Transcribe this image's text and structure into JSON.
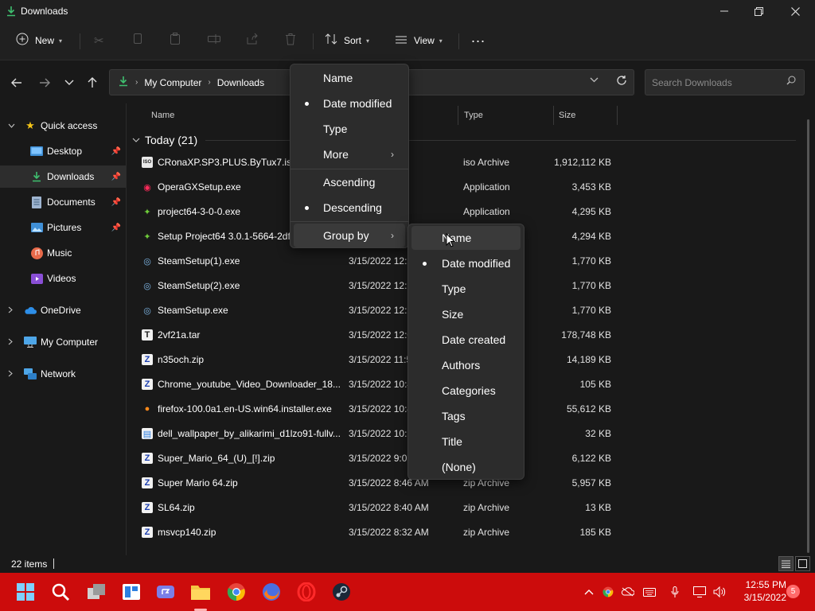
{
  "window": {
    "title": "Downloads"
  },
  "toolbar": {
    "new_label": "New",
    "sort_label": "Sort",
    "view_label": "View",
    "more_label": "..."
  },
  "address": {
    "crumbs": [
      "My Computer",
      "Downloads"
    ],
    "search_placeholder": "Search Downloads"
  },
  "sidebar": {
    "items": [
      {
        "label": "Quick access",
        "icon": "star-icon"
      },
      {
        "label": "Desktop",
        "icon": "desktop-icon"
      },
      {
        "label": "Downloads",
        "icon": "download-icon"
      },
      {
        "label": "Documents",
        "icon": "document-icon"
      },
      {
        "label": "Pictures",
        "icon": "picture-icon"
      },
      {
        "label": "Music",
        "icon": "music-icon"
      },
      {
        "label": "Videos",
        "icon": "video-icon"
      },
      {
        "label": "OneDrive",
        "icon": "cloud-icon"
      },
      {
        "label": "My Computer",
        "icon": "computer-icon"
      },
      {
        "label": "Network",
        "icon": "network-icon"
      }
    ]
  },
  "columns": {
    "name": "Name",
    "type": "Type",
    "size": "Size"
  },
  "group": {
    "label": "Today (21)"
  },
  "files": [
    {
      "name": "CRonaXP.SP3.PLUS.ByTux7.iso",
      "date": "3 PM",
      "type": "iso Archive",
      "size": "1,912,112 KB"
    },
    {
      "name": "OperaGXSetup.exe",
      "date": "6 PM",
      "type": "Application",
      "size": "3,453 KB"
    },
    {
      "name": "project64-3-0-0.exe",
      "date": "6 PM",
      "type": "Application",
      "size": "4,295 KB"
    },
    {
      "name": "Setup Project64 3.0.1-5664-2df3",
      "date": "",
      "type": "",
      "size": "4,294 KB"
    },
    {
      "name": "SteamSetup(1).exe",
      "date": "3/15/2022 12:2",
      "type": "",
      "size": "1,770 KB"
    },
    {
      "name": "SteamSetup(2).exe",
      "date": "3/15/2022 12:2",
      "type": "",
      "size": "1,770 KB"
    },
    {
      "name": "SteamSetup.exe",
      "date": "3/15/2022 12:2",
      "type": "",
      "size": "1,770 KB"
    },
    {
      "name": "2vf21a.tar",
      "date": "3/15/2022 12:0",
      "type": "",
      "size": "178,748 KB"
    },
    {
      "name": "n35och.zip",
      "date": "3/15/2022 11:5",
      "type": "",
      "size": "14,189 KB"
    },
    {
      "name": "Chrome_youtube_Video_Downloader_18....",
      "date": "3/15/2022 10:4",
      "type": "",
      "size": "105 KB"
    },
    {
      "name": "firefox-100.0a1.en-US.win64.installer.exe",
      "date": "3/15/2022 10:4",
      "type": "",
      "size": "55,612 KB"
    },
    {
      "name": "dell_wallpaper_by_alikarimi_d1lzo91-fullv...",
      "date": "3/15/2022 10:3",
      "type": "",
      "size": "32 KB"
    },
    {
      "name": "Super_Mario_64_(U)_[!].zip",
      "date": "3/15/2022 9:01",
      "type": "",
      "size": "6,122 KB"
    },
    {
      "name": "Super Mario 64.zip",
      "date": "3/15/2022 8:46 AM",
      "type": "zip Archive",
      "size": "5,957 KB"
    },
    {
      "name": "SL64.zip",
      "date": "3/15/2022 8:40 AM",
      "type": "zip Archive",
      "size": "13 KB"
    },
    {
      "name": "msvcp140.zip",
      "date": "3/15/2022 8:32 AM",
      "type": "zip Archive",
      "size": "185 KB"
    }
  ],
  "sort_menu": {
    "items": [
      {
        "label": "Name",
        "checked": false
      },
      {
        "label": "Date modified",
        "checked": true
      },
      {
        "label": "Type",
        "checked": false
      },
      {
        "label": "More",
        "checked": false
      },
      {
        "label": "Ascending",
        "checked": false
      },
      {
        "label": "Descending",
        "checked": true
      },
      {
        "label": "Group by",
        "checked": false
      }
    ]
  },
  "groupby_menu": {
    "items": [
      {
        "label": "Name",
        "checked": false
      },
      {
        "label": "Date modified",
        "checked": true
      },
      {
        "label": "Type",
        "checked": false
      },
      {
        "label": "Size",
        "checked": false
      },
      {
        "label": "Date created",
        "checked": false
      },
      {
        "label": "Authors",
        "checked": false
      },
      {
        "label": "Categories",
        "checked": false
      },
      {
        "label": "Tags",
        "checked": false
      },
      {
        "label": "Title",
        "checked": false
      },
      {
        "label": "(None)",
        "checked": false
      }
    ]
  },
  "status": {
    "item_count": "22 items"
  },
  "taskbar": {
    "time": "12:55 PM",
    "date": "3/15/2022",
    "notification_count": "5",
    "color": "#cc0c0c"
  }
}
